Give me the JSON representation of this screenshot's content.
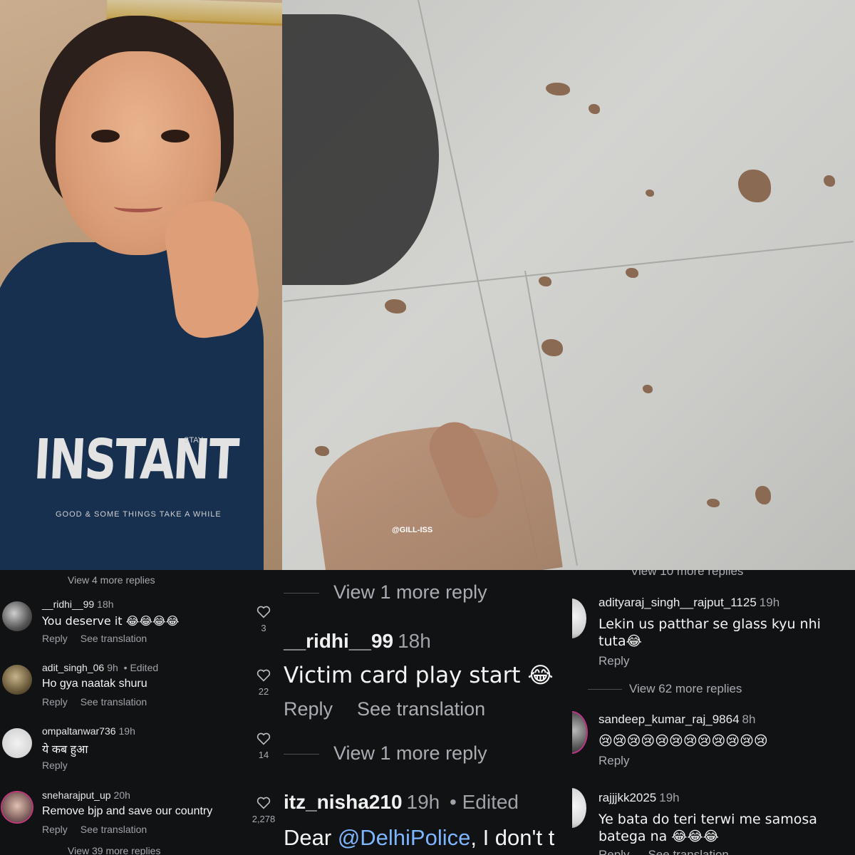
{
  "watermark": "@GILL-ISS",
  "shirt": {
    "brand": "INSTANT",
    "tag": "STAY",
    "tagline": "GOOD & SOME THINGS TAKE A WHILE"
  },
  "panel1": {
    "top_more": "View 4 more replies",
    "bottom_more": "View 39 more replies",
    "comments": [
      {
        "user": "__ridhi__99",
        "time": "18h",
        "edited": "",
        "text": "You deserve it 😂😂😂😂",
        "reply": "Reply",
        "translate": "See translation",
        "likes": "3"
      },
      {
        "user": "adit_singh_06",
        "time": "9h",
        "edited": "• Edited",
        "text": "Ho gya naatak shuru",
        "reply": "Reply",
        "translate": "See translation",
        "likes": "22"
      },
      {
        "user": "ompaltanwar736",
        "time": "19h",
        "edited": "",
        "text": "ये कब हुआ",
        "reply": "Reply",
        "translate": "",
        "likes": "14"
      },
      {
        "user": "sneharajput_up",
        "time": "20h",
        "edited": "",
        "text": "Remove bjp and save our country",
        "reply": "Reply",
        "translate": "See translation",
        "likes": "2,278"
      }
    ]
  },
  "panel2": {
    "more1": "View 1 more reply",
    "comment1": {
      "user": "__ridhi__99",
      "time": "18h",
      "text": "Victim card play start 😂",
      "reply": "Reply",
      "translate": "See translation"
    },
    "more2": "View 1 more reply",
    "comment2": {
      "user": "itz_nisha210",
      "time": "19h",
      "edited": "• Edited",
      "text_before": "Dear ",
      "mention": "@DelhiPolice",
      "text_after": ", I don't t"
    }
  },
  "panel3": {
    "top_more": "View 10 more replies",
    "c1": {
      "user": "adityaraj_singh__rajput_1125",
      "time": "19h",
      "text": "Lekin us patthar se glass kyu nhi tuta😂",
      "reply": "Reply"
    },
    "more": "View 62 more replies",
    "c2": {
      "user": "sandeep_kumar_raj_9864",
      "time": "8h",
      "text": "😢😢😢😢😢😢😢😢😢😢😢😢",
      "reply": "Reply"
    },
    "c3": {
      "user": "rajjjkk2025",
      "time": "19h",
      "text": "Ye bata do teri terwi me samosa batega na 😂😂😂",
      "reply": "Reply",
      "translate": "See translation"
    }
  }
}
